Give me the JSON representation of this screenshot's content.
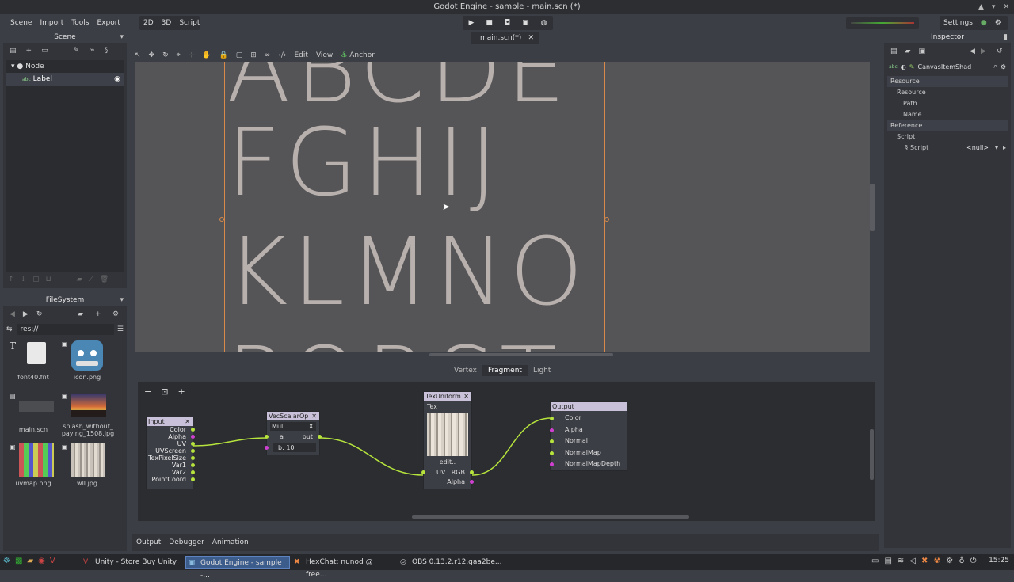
{
  "window": {
    "title": "Godot Engine - sample - main.scn (*)"
  },
  "menu": [
    "Scene",
    "Import",
    "Tools",
    "Export"
  ],
  "modes": [
    "2D",
    "3D",
    "Script"
  ],
  "settings_label": "Settings",
  "scene_tab": "main.scn(*)",
  "scene_panel": {
    "title": "Scene",
    "nodes": [
      {
        "name": "Node"
      },
      {
        "name": "Label"
      }
    ]
  },
  "filesystem": {
    "title": "FileSystem",
    "path": "res://",
    "files": [
      {
        "name": "font40.fnt"
      },
      {
        "name": "icon.png"
      },
      {
        "name": "main.scn"
      },
      {
        "name": "splash_without_\npaying_1508.jpg"
      },
      {
        "name": "uvmap.png"
      },
      {
        "name": "wll.jpg"
      }
    ]
  },
  "viewport_toolbar": {
    "edit": "Edit",
    "view": "View",
    "anchor": "Anchor"
  },
  "viewport_text": [
    "ABCDE",
    "FGHIJ",
    "KLMNO",
    "PQRST"
  ],
  "shader_tabs": [
    "Vertex",
    "Fragment",
    "Light"
  ],
  "shader_active_tab": "Fragment",
  "nodes": {
    "input": {
      "title": "Input",
      "ports": [
        "Color",
        "Alpha",
        "UV",
        "UVScreen",
        "TexPixelSize",
        "Var1",
        "Var2",
        "PointCoord"
      ]
    },
    "vecscalar": {
      "title": "VecScalarOp",
      "op": "Mul",
      "a": "a",
      "out": "out",
      "b": "b: 10"
    },
    "texuniform": {
      "title": "TexUniform",
      "name": "Tex",
      "edit": "edit..",
      "uv": "UV",
      "rgb": "RGB",
      "alpha": "Alpha"
    },
    "output": {
      "title": "Output",
      "ports": [
        "Color",
        "Alpha",
        "Normal",
        "NormalMap",
        "NormalMapDepth"
      ]
    }
  },
  "bottom_tabs": [
    "Output",
    "Debugger",
    "Animation"
  ],
  "inspector": {
    "title": "Inspector",
    "object": "CanvasItemShad",
    "rows": [
      {
        "label": "Resource",
        "indent": 0
      },
      {
        "label": "Resource",
        "indent": 1
      },
      {
        "label": "Path",
        "indent": 2
      },
      {
        "label": "Name",
        "indent": 2
      },
      {
        "label": "Reference",
        "indent": 0
      },
      {
        "label": "Script",
        "indent": 1
      }
    ],
    "script_label": "Script",
    "script_value": "<null>"
  },
  "taskbar": {
    "items": [
      "Unity - Store Buy Unity",
      "Godot Engine - sample -...",
      "HexChat: nunod @ free...",
      "OBS 0.13.2.r12.gaa2be..."
    ],
    "clock": "15:25"
  },
  "colors": {
    "accent": "#b6e33c",
    "selection": "#c9c1d9",
    "active_task": "#3c5c8c"
  }
}
